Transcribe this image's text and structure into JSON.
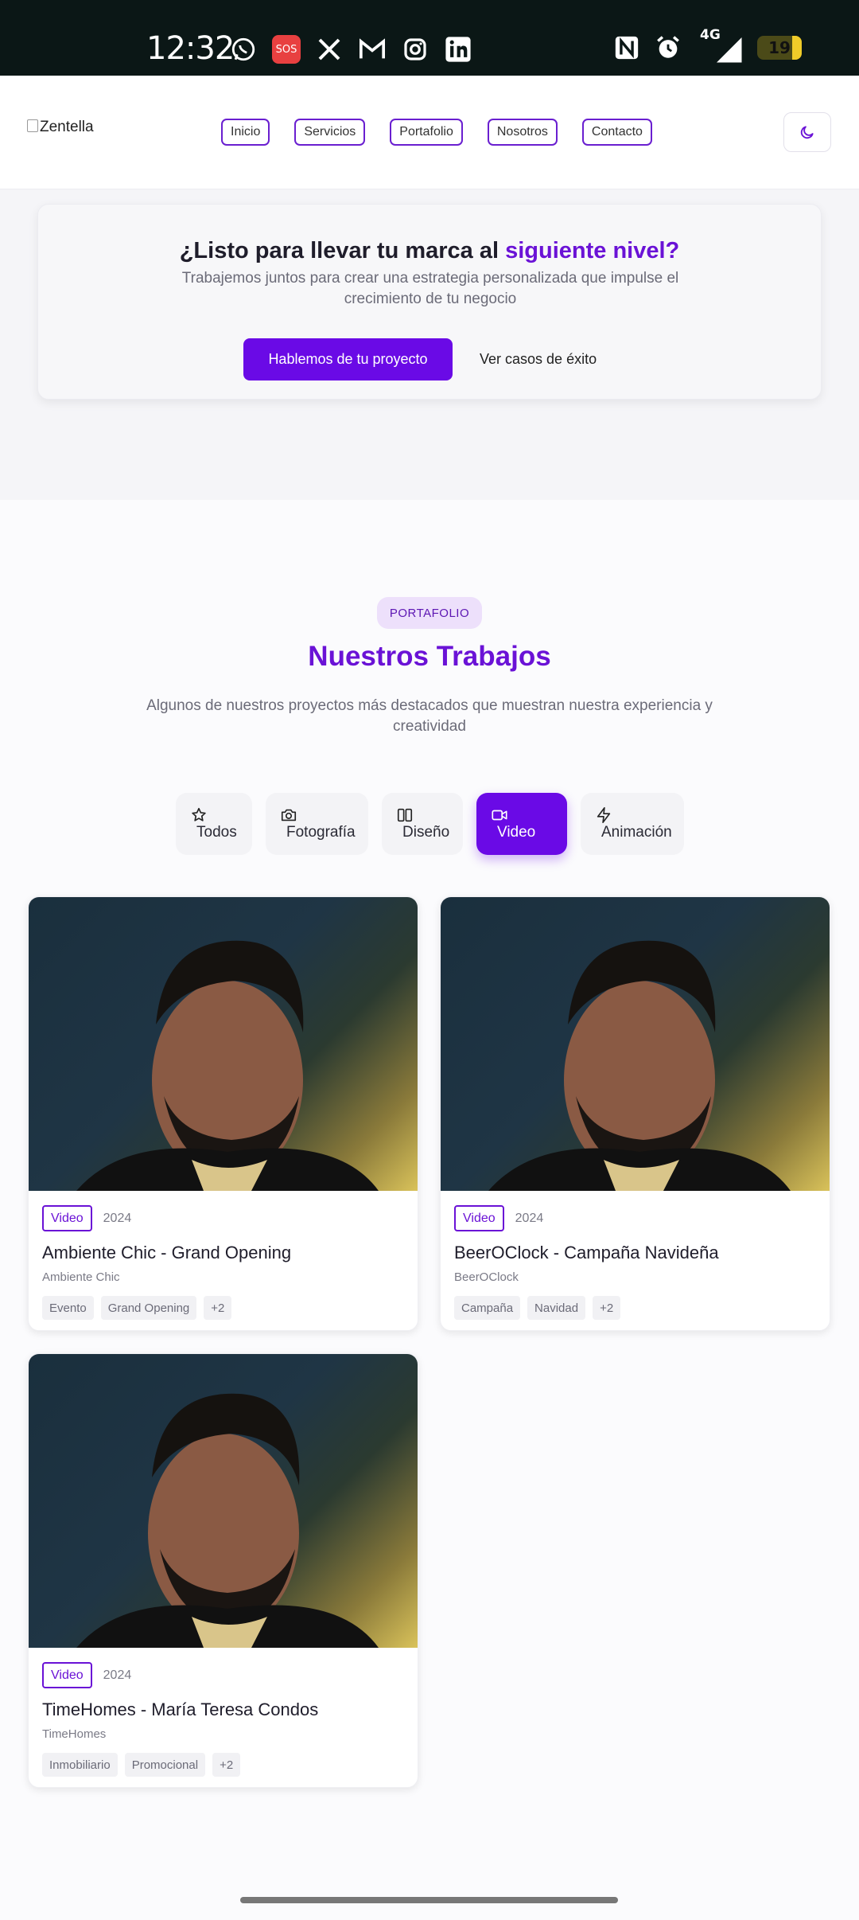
{
  "status_bar": {
    "time": "12:32",
    "left_icons": [
      "whatsapp-icon",
      "sos-icon",
      "x-icon",
      "gmail-icon",
      "instagram-icon",
      "linkedin-icon"
    ],
    "sos_label": "SOS",
    "network": "4G",
    "battery": "19"
  },
  "header": {
    "logo_alt": "Zentella",
    "nav": [
      "Inicio",
      "Servicios",
      "Portafolio",
      "Nosotros",
      "Contacto"
    ],
    "theme_icon": "moon-icon"
  },
  "cta": {
    "title_main": "¿Listo para llevar tu marca al ",
    "title_accent": "siguiente nivel?",
    "subtitle": "Trabajemos juntos para crear una estrategia personalizada que impulse el crecimiento de tu negocio",
    "primary_button": "Hablemos de tu proyecto",
    "secondary_link": "Ver casos de éxito"
  },
  "portfolio": {
    "pill": "PORTAFOLIO",
    "title": "Nuestros Trabajos",
    "subtitle": "Algunos de nuestros proyectos más destacados que muestran nuestra experiencia y creatividad",
    "filters": [
      {
        "label": "Todos",
        "icon": "star-icon",
        "active": false
      },
      {
        "label": "Fotografía",
        "icon": "camera-icon",
        "active": false
      },
      {
        "label": "Diseño",
        "icon": "columns-icon",
        "active": false
      },
      {
        "label": "Video",
        "icon": "video-icon",
        "active": true
      },
      {
        "label": "Animación",
        "icon": "zap-icon",
        "active": false
      }
    ],
    "projects": [
      {
        "badge": "Video",
        "year": "2024",
        "title": "Ambiente Chic - Grand Opening",
        "client": "Ambiente Chic",
        "tags": [
          "Evento",
          "Grand Opening",
          "+2"
        ]
      },
      {
        "badge": "Video",
        "year": "2024",
        "title": "BeerOClock - Campaña Navideña",
        "client": "BeerOClock",
        "tags": [
          "Campaña",
          "Navidad",
          "+2"
        ]
      },
      {
        "badge": "Video",
        "year": "2024",
        "title": "TimeHomes - María Teresa Condos",
        "client": "TimeHomes",
        "tags": [
          "Inmobiliario",
          "Promocional",
          "+2"
        ]
      }
    ]
  }
}
